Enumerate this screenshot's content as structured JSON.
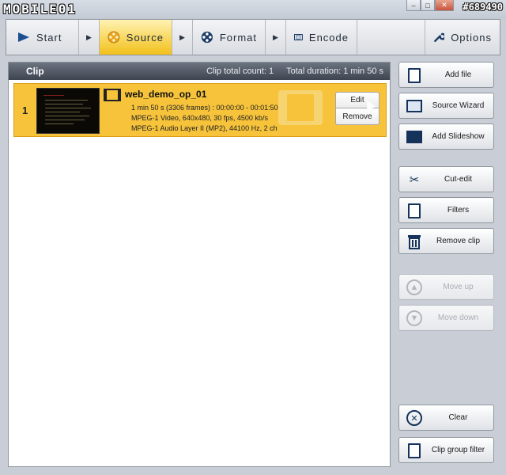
{
  "app": {
    "logo": "MOBILE01",
    "watermark": "#689490"
  },
  "window_buttons": {
    "minimize": "–",
    "maximize": "□",
    "close": "✕"
  },
  "toolbar": {
    "start": "Start",
    "source": "Source",
    "format": "Format",
    "encode": "Encode",
    "options": "Options",
    "arrow": "▶"
  },
  "clip_panel": {
    "title": "Clip",
    "total_count": "Clip total count: 1",
    "total_duration": "Total duration: 1 min 50 s",
    "clips": [
      {
        "index": "1",
        "name": "web_demo_op_01",
        "duration_line": "1 min 50 s (3306 frames) : 00:00:00 - 00:01:50",
        "video_line": "MPEG-1 Video,  640x480,  30  fps,  4500 kb/s",
        "audio_line": "MPEG-1 Audio Layer II (MP2),  44100  Hz,  2 ch",
        "edit_label": "Edit",
        "remove_label": "Remove"
      }
    ]
  },
  "side_buttons": {
    "add_file": "Add file",
    "source_wizard": "Source Wizard",
    "add_slideshow": "Add Slideshow",
    "cut_edit": "Cut-edit",
    "filters": "Filters",
    "remove_clip": "Remove clip",
    "move_up": "Move up",
    "move_down": "Move down",
    "clear": "Clear",
    "clip_group_filter": "Clip group filter"
  },
  "colors": {
    "selected_clip": "#f6c33b",
    "toolbar_active": "#f2c019",
    "panel_header": "#4a515c",
    "icon_blue": "#15335a"
  }
}
